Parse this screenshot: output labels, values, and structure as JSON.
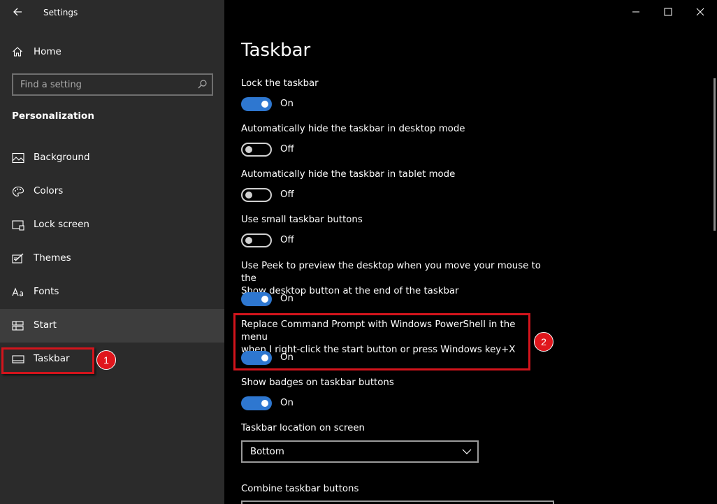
{
  "window": {
    "title": "Settings",
    "controls": [
      "minimize-icon",
      "maximize-icon",
      "close-icon"
    ]
  },
  "sidebar": {
    "home_label": "Home",
    "search_placeholder": "Find a setting",
    "section_title": "Personalization",
    "items": [
      {
        "label": "Background",
        "icon": "picture-icon"
      },
      {
        "label": "Colors",
        "icon": "palette-icon"
      },
      {
        "label": "Lock screen",
        "icon": "lock-screen-icon"
      },
      {
        "label": "Themes",
        "icon": "themes-icon"
      },
      {
        "label": "Fonts",
        "icon": "fonts-icon"
      },
      {
        "label": "Start",
        "icon": "start-icon"
      },
      {
        "label": "Taskbar",
        "icon": "taskbar-icon"
      }
    ]
  },
  "main": {
    "title": "Taskbar",
    "settings": [
      {
        "label": "Lock the taskbar",
        "state": "On"
      },
      {
        "label": "Automatically hide the taskbar in desktop mode",
        "state": "Off"
      },
      {
        "label": "Automatically hide the taskbar in tablet mode",
        "state": "Off"
      },
      {
        "label": "Use small taskbar buttons",
        "state": "Off"
      },
      {
        "label_line1": "Use Peek to preview the desktop when you move your mouse to the",
        "label_line2": "Show desktop button at the end of the taskbar",
        "state": "On"
      },
      {
        "label_line1": "Replace Command Prompt with Windows PowerShell in the menu",
        "label_line2": "when I right-click the start button or press Windows key+X",
        "state": "On"
      },
      {
        "label": "Show badges on taskbar buttons",
        "state": "On"
      }
    ],
    "location_label": "Taskbar location on screen",
    "location_value": "Bottom",
    "combine_label": "Combine taskbar buttons"
  },
  "annotations": {
    "badge1": "1",
    "badge2": "2",
    "color": "#d3141c"
  },
  "colors": {
    "accent": "#2e77d0",
    "sidebar_bg": "#2b2b2b",
    "main_bg": "#000000"
  }
}
